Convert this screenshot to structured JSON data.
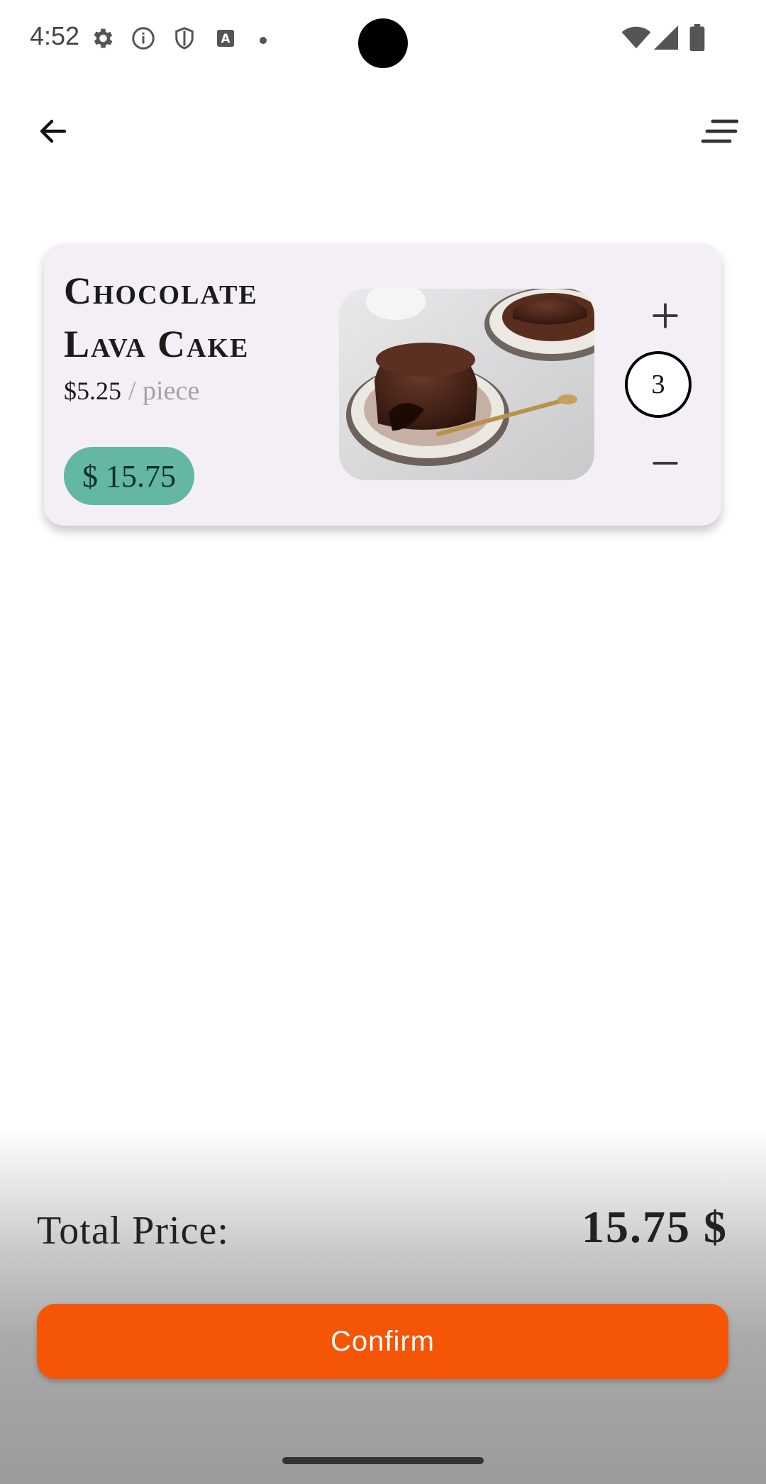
{
  "status_bar": {
    "time": "4:52",
    "left_icons": [
      "gear-icon",
      "info-icon",
      "shield-icon",
      "text-box-icon",
      "dot-icon"
    ],
    "right_icons": [
      "wifi-icon",
      "cell-signal-icon",
      "battery-icon"
    ]
  },
  "app_bar": {
    "back_icon": "arrow-left-icon",
    "menu_icon": "sort-lines-icon"
  },
  "cart": {
    "items": [
      {
        "name_line1": "Chocolate",
        "name_line2": "Lava Cake",
        "unit_price": "$5.25",
        "unit_label": "/ piece",
        "subtotal": "$ 15.75",
        "quantity": "3",
        "image": "chocolate-lava-cake-photo"
      }
    ]
  },
  "checkout": {
    "total_label": "Total Price:",
    "total_value": "15.75 $",
    "confirm_label": "Confirm"
  },
  "colors": {
    "accent_orange": "#f45507",
    "subtotal_teal": "#63b7a4",
    "card_background": "#f4eff6"
  }
}
